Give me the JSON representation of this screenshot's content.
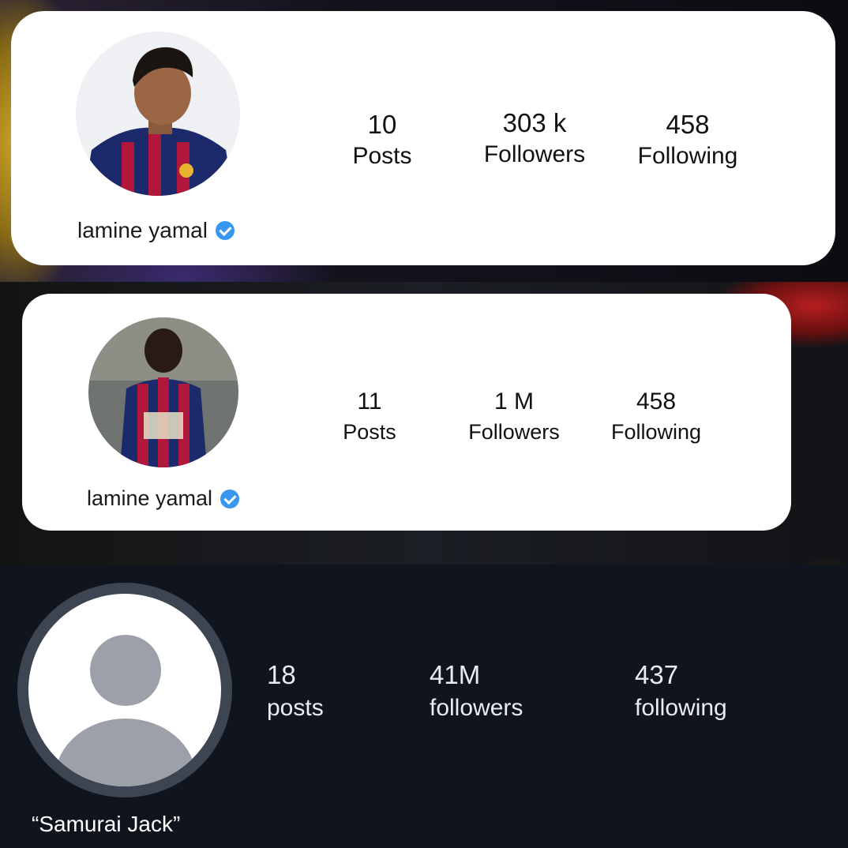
{
  "profiles": [
    {
      "username": "lamine yamal",
      "verified": true,
      "stats": [
        {
          "value": "10",
          "label": "Posts"
        },
        {
          "value": "303 k",
          "label": "Followers"
        },
        {
          "value": "458",
          "label": "Following"
        }
      ]
    },
    {
      "username": "lamine yamal",
      "verified": true,
      "stats": [
        {
          "value": "11",
          "label": "Posts"
        },
        {
          "value": "1 M",
          "label": "Followers"
        },
        {
          "value": "458",
          "label": "Following"
        }
      ]
    },
    {
      "username": "“Samurai Jack”",
      "verified": false,
      "avatar_icon": "default-user-icon",
      "stats": [
        {
          "value": "18",
          "label": "posts"
        },
        {
          "value": "41M",
          "label": "followers"
        },
        {
          "value": "437",
          "label": "following"
        }
      ]
    }
  ],
  "colors": {
    "verified_badge": "#3897f0",
    "card_background": "#ffffff",
    "dark_background": "#10141c",
    "dark_text": "#e9ecf1",
    "placeholder_avatar": "#9ca0a8"
  }
}
